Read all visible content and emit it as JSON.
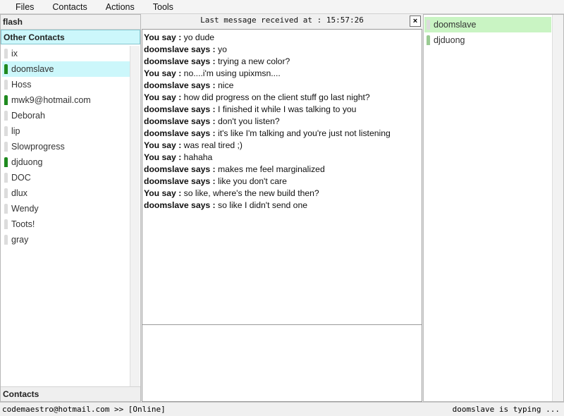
{
  "menu": [
    "Files",
    "Contacts",
    "Actions",
    "Tools"
  ],
  "left": {
    "group_flash": "flash",
    "group_other": "Other Contacts",
    "group_contacts": "Contacts",
    "contacts": [
      {
        "name": "ix",
        "status": "offline"
      },
      {
        "name": "doomslave",
        "status": "online",
        "selected": true
      },
      {
        "name": "Hoss",
        "status": "offline"
      },
      {
        "name": "mwk9@hotmail.com",
        "status": "online"
      },
      {
        "name": "Deborah",
        "status": "offline"
      },
      {
        "name": "lip",
        "status": "offline"
      },
      {
        "name": "Slowprogress",
        "status": "offline"
      },
      {
        "name": "djduong",
        "status": "online"
      },
      {
        "name": "DOC",
        "status": "offline"
      },
      {
        "name": "dlux",
        "status": "offline"
      },
      {
        "name": "Wendy",
        "status": "offline"
      },
      {
        "name": "Toots!",
        "status": "offline"
      },
      {
        "name": "gray",
        "status": "offline"
      }
    ]
  },
  "chat": {
    "header": "Last message received at : 15:57:26",
    "close_label": "×",
    "messages": [
      {
        "speaker": "You say :",
        "text": " yo dude"
      },
      {
        "speaker": "doomslave says :",
        "text": " yo"
      },
      {
        "speaker": "doomslave says :",
        "text": " trying a new color?"
      },
      {
        "speaker": "You say :",
        "text": " no....i'm using upixmsn...."
      },
      {
        "speaker": "doomslave says :",
        "text": " nice"
      },
      {
        "speaker": "You say :",
        "text": " how did progress on the client stuff go last night?"
      },
      {
        "speaker": "doomslave says :",
        "text": " I finished it while I was talking to you"
      },
      {
        "speaker": "doomslave says :",
        "text": " don't you listen?"
      },
      {
        "speaker": "doomslave says :",
        "text": " it's like I'm talking and you're just not listening"
      },
      {
        "speaker": "You say :",
        "text": " was real tired ;)"
      },
      {
        "speaker": "You say :",
        "text": " hahaha"
      },
      {
        "speaker": "doomslave says :",
        "text": " makes me feel marginalized"
      },
      {
        "speaker": "doomslave says :",
        "text": " like you don't care"
      },
      {
        "speaker": "You say :",
        "text": " so like, where's the new build then?"
      },
      {
        "speaker": "doomslave says :",
        "text": " so like I didn't send one"
      }
    ],
    "input_value": ""
  },
  "right": {
    "participants": [
      {
        "name": "doomslave",
        "status": "offline",
        "active": true
      },
      {
        "name": "djduong",
        "status": "online",
        "active": false
      }
    ]
  },
  "statusbar": {
    "left": "codemaestro@hotmail.com >> [Online]",
    "right": "doomslave is typing ..."
  },
  "colors": {
    "selected_contact": "#ccf7fb",
    "active_participant": "#c9f4c3",
    "online": "#1f8a1f",
    "offline": "#dcdcdc"
  }
}
